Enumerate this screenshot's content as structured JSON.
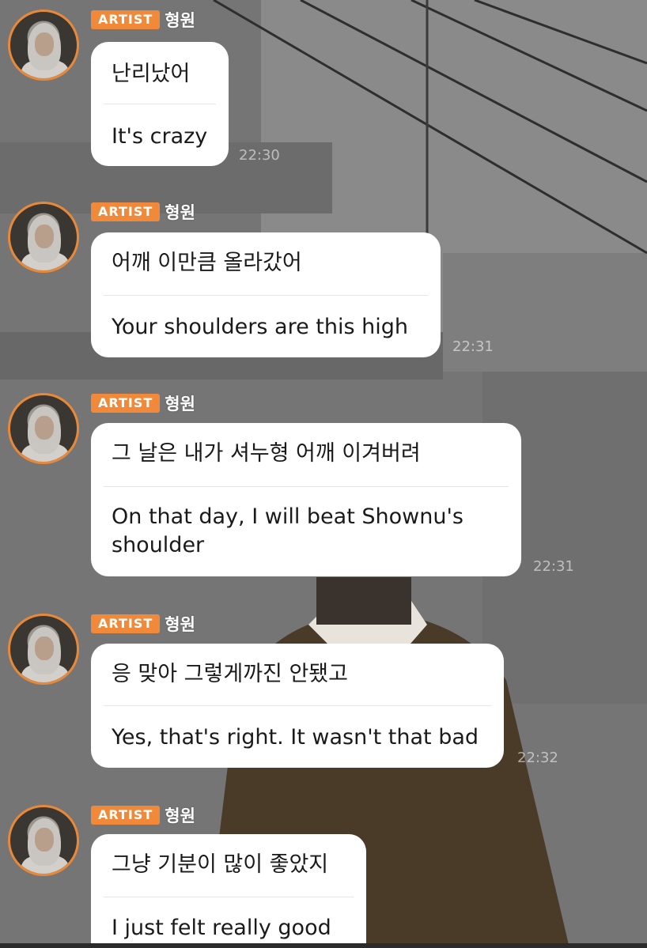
{
  "messages": [
    {
      "badge": "ARTIST",
      "sender": "형원",
      "korean": "난리났어",
      "english": "It's crazy",
      "time": "22:30"
    },
    {
      "badge": "ARTIST",
      "sender": "형원",
      "korean": "어깨 이만큼 올라갔어",
      "english": "Your shoulders are this high",
      "time": "22:31"
    },
    {
      "badge": "ARTIST",
      "sender": "형원",
      "korean": "그 날은 내가 셔누형 어깨 이겨버려",
      "english": "On that day, I will beat Shownu's shoulder",
      "time": "22:31"
    },
    {
      "badge": "ARTIST",
      "sender": "형원",
      "korean": "응 맞아 그렇게까진 안됐고",
      "english": "Yes, that's right. It wasn't that bad",
      "time": "22:32"
    },
    {
      "badge": "ARTIST",
      "sender": "형원",
      "korean": "그냥 기분이 많이 좋았지",
      "english": "I just felt really good",
      "time": ""
    }
  ],
  "colors": {
    "badge": "#f08a3a",
    "avatar_ring": "#e8893a",
    "bubble": "#ffffff"
  },
  "icons": [
    "avatar-icon"
  ]
}
